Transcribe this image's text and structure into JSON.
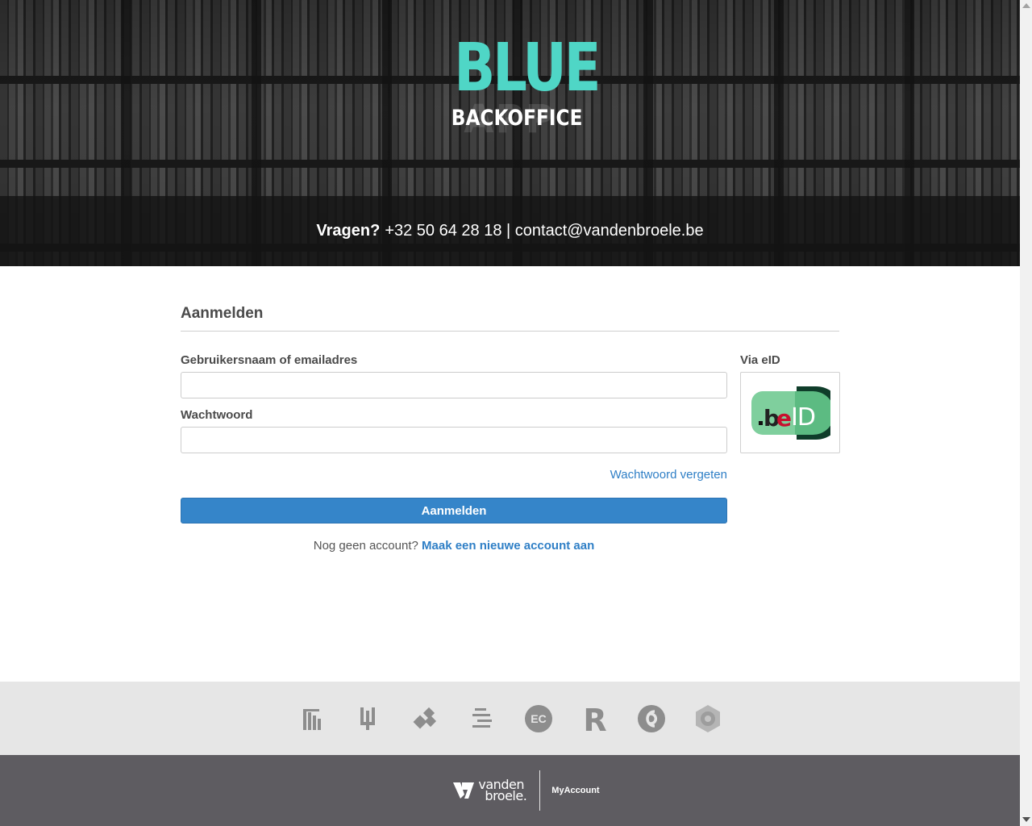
{
  "header": {
    "logo_main": "BLUE",
    "logo_ghost": "APP",
    "logo_sub": "BACKOFFICE",
    "contact_label": "Vragen?",
    "contact_info": "+32 50 64 28 18 | contact@vandenbroele.be"
  },
  "login": {
    "title": "Aanmelden",
    "username_label": "Gebruikersnaam of emailadres",
    "username_value": "",
    "password_label": "Wachtwoord",
    "password_value": "",
    "eid_label": "Via eID",
    "eid_logo_text": ".beID",
    "forgot_link": "Wachtwoord vergeten",
    "submit_label": "Aanmelden",
    "register_prompt": "Nog geen account?",
    "register_link": "Maak een nieuwe account aan"
  },
  "brands": [
    "brand-logo-1",
    "brand-logo-2",
    "brand-logo-3",
    "brand-logo-4",
    "brand-logo-ec",
    "brand-logo-r",
    "brand-logo-7",
    "brand-logo-8"
  ],
  "brand_ec_text": "EC",
  "brand_r_text": "R",
  "footer": {
    "company_line1": "vanden",
    "company_line2": "broele.",
    "account_label": "MyAccount"
  },
  "colors": {
    "accent": "#3585c9",
    "link": "#2f7fc6",
    "logo_teal": "#4fd6c6",
    "footer_bg": "#5e5c61",
    "brands_bg": "#e6e6e6"
  }
}
